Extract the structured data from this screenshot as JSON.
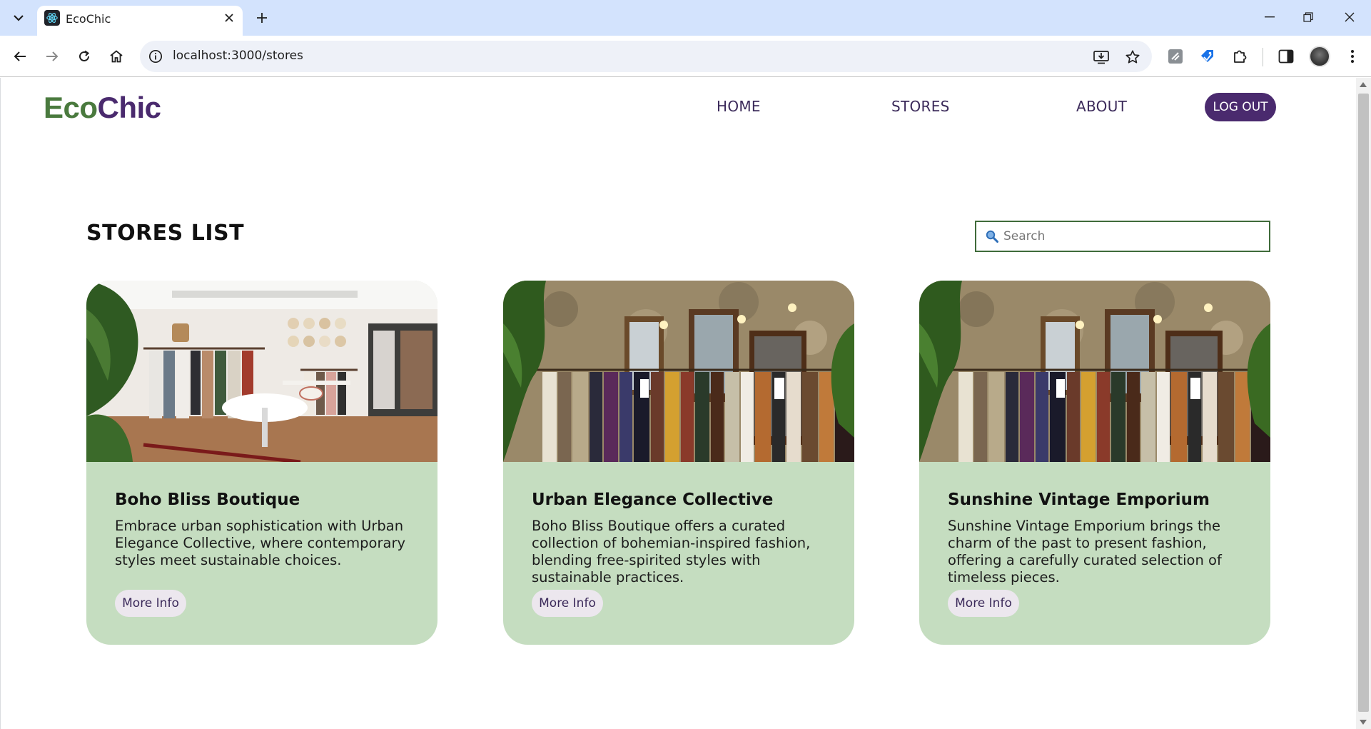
{
  "browser": {
    "tab_title": "EcoChic",
    "url": "localhost:3000/stores"
  },
  "site": {
    "logo_part1": "Eco",
    "logo_part2": "Chic",
    "nav": {
      "home": "HOME",
      "stores": "STORES",
      "about": "ABOUT",
      "logout": "LOG OUT"
    }
  },
  "stores": {
    "title": "STORES LIST",
    "search_placeholder": "Search",
    "cards": [
      {
        "name": "Boho Bliss Boutique",
        "description": "Embrace urban sophistication with Urban Elegance Collective, where contemporary styles meet sustainable choices.",
        "button": "More Info",
        "image": "boutique-interior-photo"
      },
      {
        "name": "Urban Elegance Collective",
        "description": "Boho Bliss Boutique offers a curated collection of bohemian-inspired fashion, blending free-spirited styles with sustainable practices.",
        "button": "More Info",
        "image": "vintage-clothing-rack-photo"
      },
      {
        "name": "Sunshine Vintage Emporium",
        "description": "Sunshine Vintage Emporium brings the charm of the past to present fashion, offering a carefully curated selection of timeless pieces.",
        "button": "More Info",
        "image": "vintage-clothing-rack-photo"
      }
    ]
  },
  "colors": {
    "logo_green": "#4a7a3e",
    "logo_purple": "#4a2a6e",
    "card_bg": "#c5ddc0",
    "search_border": "#3f6b3a"
  }
}
